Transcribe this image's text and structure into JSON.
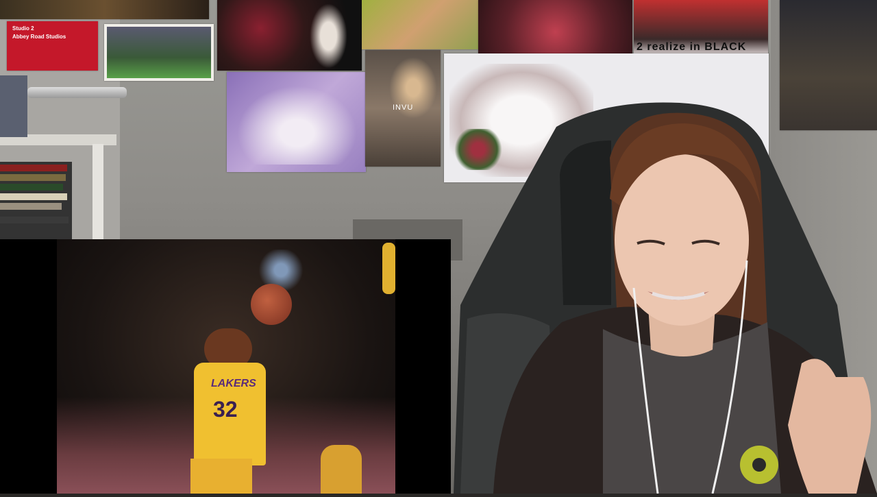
{
  "posters": {
    "abbey_road_line1": "Studio 2",
    "abbey_road_line2": "Abbey Road Studios",
    "invu": "INVU",
    "realize": "2 realize in BLACK"
  },
  "video": {
    "jersey_team": "LAKERS",
    "jersey_number": "32"
  },
  "colors": {
    "lakers_gold": "#f0c030",
    "abbey_red": "#c4182a",
    "hoodie": "#2a2220"
  }
}
